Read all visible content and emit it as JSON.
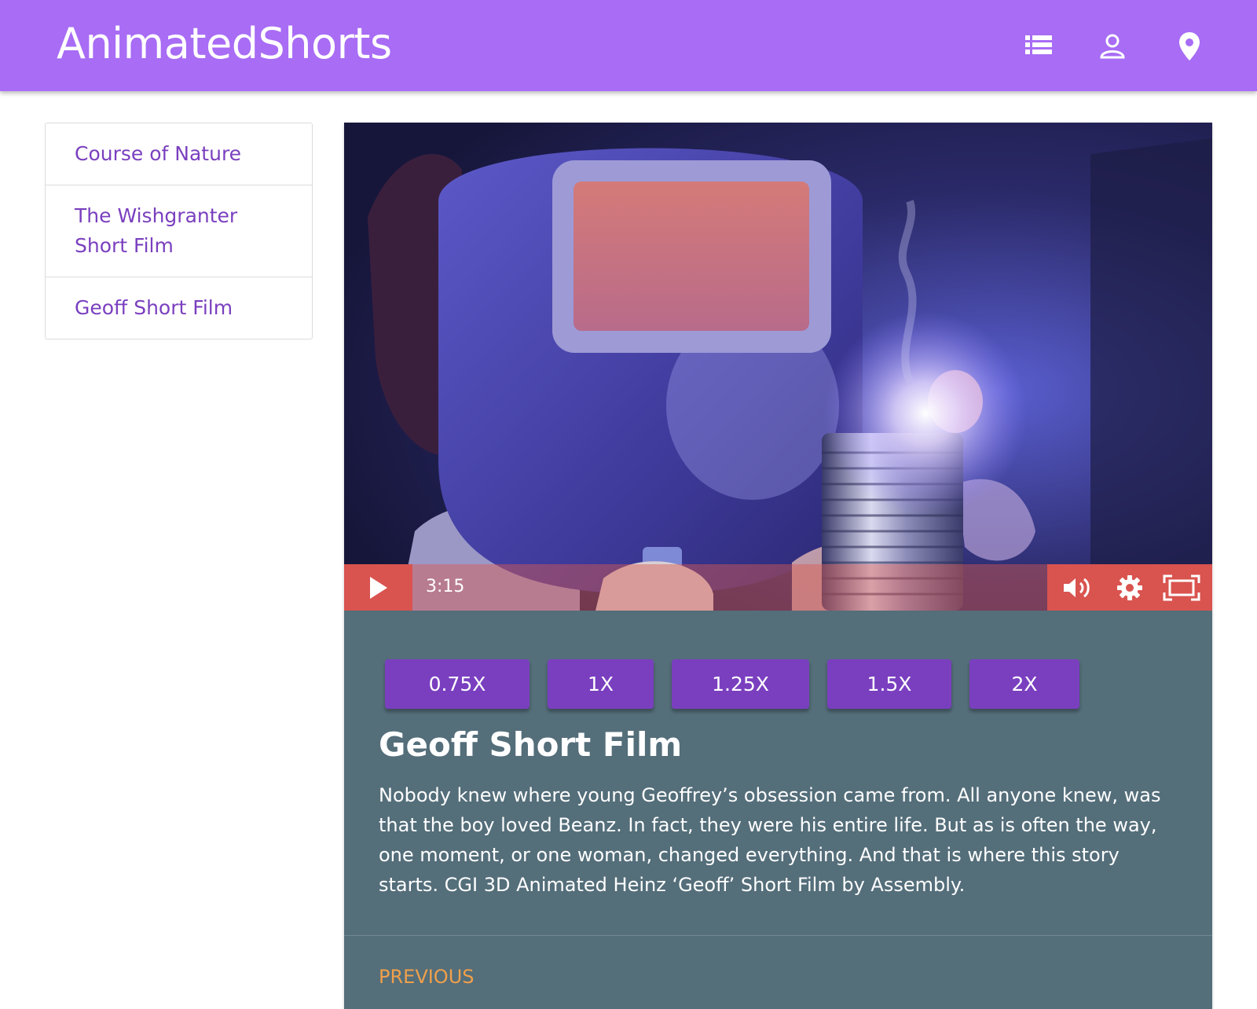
{
  "app": {
    "title": "AnimatedShorts"
  },
  "nav": {
    "icons": [
      "list-icon",
      "person-icon",
      "location-pin-icon"
    ]
  },
  "sidebar": {
    "items": [
      {
        "label": "Course of Nature"
      },
      {
        "label": "The Wishgranter Short Film"
      },
      {
        "label": "Geoff Short Film"
      }
    ]
  },
  "player": {
    "time": "3:15",
    "icons": [
      "play-icon",
      "volume-icon",
      "settings-gear-icon",
      "fullscreen-icon"
    ]
  },
  "speeds": [
    {
      "label": "0.75X"
    },
    {
      "label": "1X"
    },
    {
      "label": "1.25X"
    },
    {
      "label": "1.5X"
    },
    {
      "label": "2X"
    }
  ],
  "video": {
    "title": "Geoff Short Film",
    "description": "Nobody knew where young Geoffrey’s obsession came from. All anyone knew, was that the boy loved Beanz. In fact, they were his entire life. But as is often the way, one moment, or one woman, changed everything. And that is where this story starts. CGI 3D Animated Heinz ‘Geoff’ Short Film by Assembly."
  },
  "pager": {
    "previous_label": "PREVIOUS"
  },
  "colors": {
    "header": "#a86cf5",
    "accent": "#7a3fbf",
    "panel": "#546e7a",
    "controls": "#d9534f",
    "previous": "#f0a04b"
  }
}
